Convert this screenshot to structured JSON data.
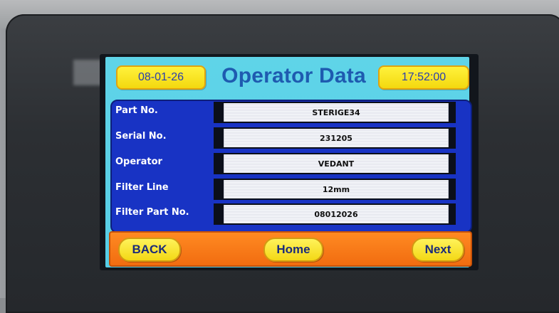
{
  "header": {
    "date": "08-01-26",
    "title": "Operator Data",
    "time": "17:52:00"
  },
  "rows": [
    {
      "label": "Part No.",
      "value": "STERIGE34"
    },
    {
      "label": "Serial No.",
      "value": "231205"
    },
    {
      "label": "Operator",
      "value": "VEDANT"
    },
    {
      "label": "Filter Line",
      "value": "12mm"
    },
    {
      "label": "Filter Part No.",
      "value": "08012026"
    }
  ],
  "footer": {
    "back_label": "BACK",
    "home_label": "Home",
    "next_label": "Next"
  },
  "colors": {
    "panel": "#5fd4e8",
    "table": "#1833c4",
    "header_box": "#f3d80f",
    "footer": "#f16c10",
    "title": "#1e5bb0"
  }
}
